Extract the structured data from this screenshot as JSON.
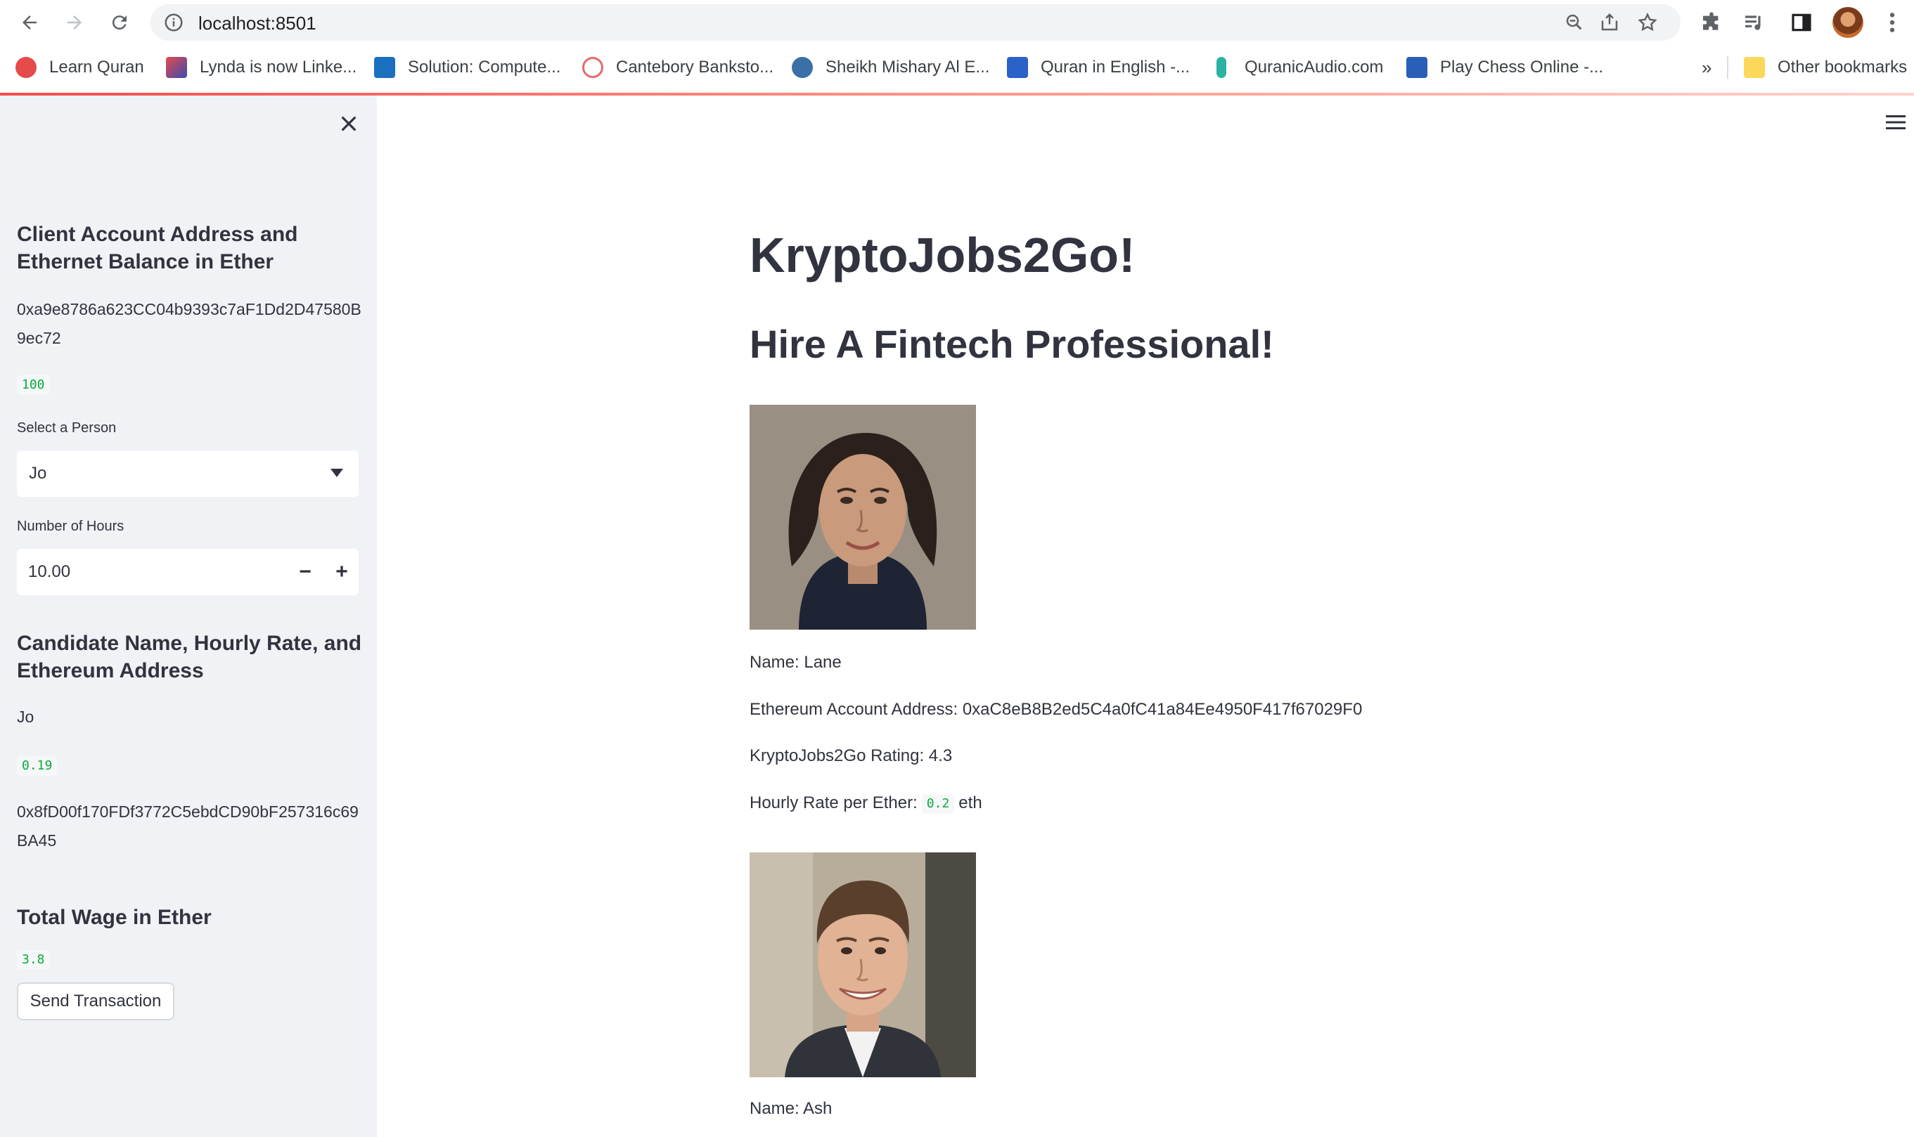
{
  "browser": {
    "url": "localhost:8501",
    "bookmarks": [
      {
        "label": "Learn Quran",
        "color": "#e64a4a"
      },
      {
        "label": "Lynda is now Linke...",
        "color": "#3b4bb0"
      },
      {
        "label": "Solution: Compute...",
        "color": "#1b6fbf"
      },
      {
        "label": "Cantebory Banksto...",
        "color": "#e66a6a"
      },
      {
        "label": "Sheikh Mishary Al E...",
        "color": "#3a6fa8"
      },
      {
        "label": "Quran in English -...",
        "color": "#2a62c8"
      },
      {
        "label": "QuranicAudio.com",
        "color": "#2ab3a3"
      },
      {
        "label": "Play Chess Online -...",
        "color": "#2a5fb8"
      }
    ],
    "overflow": "»",
    "other_bookmarks": "Other bookmarks"
  },
  "sidebar": {
    "heading1": "Client Account Address and Ethernet Balance in Ether",
    "client_address": "0xa9e8786a623CC04b9393c7aF1Dd2D47580B9ec72",
    "balance": "100",
    "select_label": "Select a Person",
    "select_value": "Jo",
    "hours_label": "Number of Hours",
    "hours_value": "10.00",
    "minus": "−",
    "plus": "+",
    "heading2": "Candidate Name, Hourly Rate, and Ethereum Address",
    "candidate_name": "Jo",
    "candidate_rate": "0.19",
    "candidate_address": "0x8fD00f170FDf3772C5ebdCD90bF257316c69BA45",
    "heading3": "Total Wage in Ether",
    "total_wage": "3.8",
    "send_label": "Send Transaction"
  },
  "main": {
    "title": "KryptoJobs2Go!",
    "subtitle": "Hire A Fintech Professional!",
    "candidates": [
      {
        "name": "Name: Lane",
        "address": "Ethereum Account Address: 0xaC8eB8B2ed5C4a0fC41a84Ee4950F417f67029F0",
        "rating": "KryptoJobs2Go Rating: 4.3",
        "rate_label": "Hourly Rate per Ether:",
        "rate_value": "0.2",
        "rate_unit": "eth"
      },
      {
        "name": "Name: Ash"
      }
    ]
  },
  "colors": {
    "sidebar_bg": "#f0f2f6",
    "accent": "#ff4b4b",
    "code_green": "#09ab3b"
  }
}
